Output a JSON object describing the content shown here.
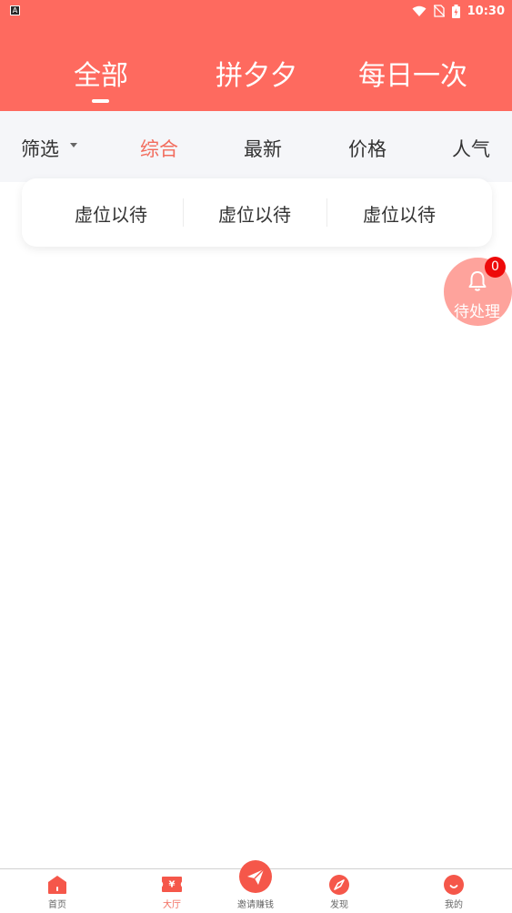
{
  "status_bar": {
    "time": "10:30",
    "app_icon_letter": "A"
  },
  "top_tabs": [
    {
      "label": "全部",
      "active": true
    },
    {
      "label": "拼夕夕",
      "active": false
    },
    {
      "label": "每日一次",
      "active": false
    }
  ],
  "filter_bar": {
    "filter_label": "筛选",
    "sorts": [
      {
        "label": "综合",
        "active": true
      },
      {
        "label": "最新",
        "active": false
      },
      {
        "label": "价格",
        "active": false
      },
      {
        "label": "人气",
        "active": false
      }
    ]
  },
  "sub_categories": [
    "虚位以待",
    "虚位以待",
    "虚位以待"
  ],
  "pending": {
    "label": "待处理",
    "count": "0"
  },
  "bottom_nav": [
    {
      "label": "首页",
      "icon": "home-icon",
      "active": false
    },
    {
      "label": "大厅",
      "icon": "ticket-icon",
      "active": true
    },
    {
      "label": "邀请赚钱",
      "icon": "paper-plane-icon",
      "active": false
    },
    {
      "label": "发现",
      "icon": "compass-icon",
      "active": false
    },
    {
      "label": "我的",
      "icon": "smile-icon",
      "active": false
    }
  ],
  "colors": {
    "brand": "#fe6a5f",
    "active_text": "#f26c5d",
    "badge": "#ee0a0a"
  }
}
